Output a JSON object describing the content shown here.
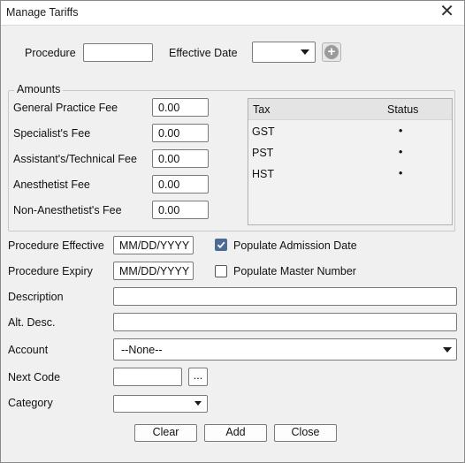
{
  "window": {
    "title": "Manage Tariffs",
    "close_glyph": "✕"
  },
  "header": {
    "procedure_label": "Procedure",
    "procedure_value": "",
    "effective_date_label": "Effective Date",
    "effective_date_value": "",
    "add_icon": "plus-circle-icon",
    "add_glyph": "+"
  },
  "amounts": {
    "legend": "Amounts",
    "fees": [
      {
        "label": "General Practice Fee",
        "value": "0.00"
      },
      {
        "label": "Specialist's Fee",
        "value": "0.00"
      },
      {
        "label": "Assistant's/Technical Fee",
        "value": "0.00"
      },
      {
        "label": "Anesthetist Fee",
        "value": "0.00"
      },
      {
        "label": "Non-Anesthetist's Fee",
        "value": "0.00"
      }
    ],
    "tax_table": {
      "headers": [
        "Tax",
        "Status"
      ],
      "rows": [
        {
          "tax": "GST",
          "status": "•"
        },
        {
          "tax": "PST",
          "status": "•"
        },
        {
          "tax": "HST",
          "status": "•"
        }
      ]
    }
  },
  "form": {
    "procedure_effective_label": "Procedure Effective",
    "procedure_effective_placeholder": "MM/DD/YYYY",
    "populate_admission_label": "Populate Admission Date",
    "populate_admission_checked": true,
    "procedure_expiry_label": "Procedure Expiry",
    "procedure_expiry_placeholder": "MM/DD/YYYY",
    "populate_master_label": "Populate Master Number",
    "populate_master_checked": false,
    "description_label": "Description",
    "description_value": "",
    "alt_desc_label": "Alt. Desc.",
    "alt_desc_value": "",
    "account_label": "Account",
    "account_value": "--None--",
    "next_code_label": "Next Code",
    "next_code_value": "",
    "browse_label": "...",
    "category_label": "Category",
    "category_value": ""
  },
  "buttons": {
    "clear": "Clear",
    "add": "Add",
    "close": "Close"
  },
  "colors": {
    "window_bg": "#f0f0f0",
    "checkbox_accent": "#4d6a96"
  }
}
